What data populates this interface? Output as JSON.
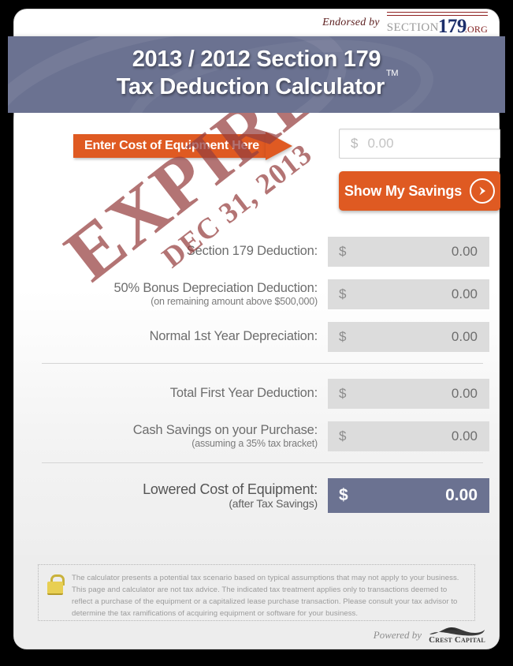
{
  "endorsement": {
    "prefix": "Endorsed by",
    "logo": {
      "section": "SECTION",
      "number": "179",
      "tld": ".ORG"
    }
  },
  "header": {
    "line1": "2013 / 2012 Section 179",
    "line2": "Tax Deduction Calculator",
    "trademark": "TM"
  },
  "entry": {
    "arrow_label": "Enter Cost of Equipment Here",
    "input_currency": "$",
    "input_placeholder": "0.00",
    "input_value": ""
  },
  "cta": {
    "label": "Show My Savings",
    "icon": "arrow-right-circle-icon"
  },
  "results": [
    {
      "label": "Section 179 Deduction:",
      "sub": "",
      "currency": "$",
      "value": "0.00"
    },
    {
      "label": "50% Bonus Depreciation Deduction:",
      "sub": "(on remaining amount above $500,000)",
      "currency": "$",
      "value": "0.00"
    },
    {
      "label": "Normal 1st Year Depreciation:",
      "sub": "",
      "currency": "$",
      "value": "0.00"
    },
    {
      "label": "Total First Year Deduction:",
      "sub": "",
      "currency": "$",
      "value": "0.00"
    },
    {
      "label": "Cash Savings on your Purchase:",
      "sub": "(assuming a 35% tax bracket)",
      "currency": "$",
      "value": "0.00"
    },
    {
      "label": "Lowered Cost of Equipment:",
      "sub": "(after Tax Savings)",
      "currency": "$",
      "value": "0.00"
    }
  ],
  "stamp": {
    "main": "EXPIRED",
    "sub": "DEC 31, 2013"
  },
  "disclaimer": {
    "icon": "padlock-icon",
    "text": "The calculator presents a potential tax scenario based on typical assumptions that may not apply to your business. This page and calculator are not tax advice. The indicated tax treatment applies only to transactions deemed to reflect a purchase of the equipment or a capitalized lease purchase transaction. Please consult your tax advisor to determine the tax ramifications of acquiring equipment or software for your business."
  },
  "powered": {
    "label": "Powered by",
    "brand": "Crest Capital"
  },
  "colors": {
    "header_slate": "#6b7291",
    "accent_orange": "#df5a22",
    "stamp_red": "#963e3e",
    "field_gray": "#dcdcdc"
  }
}
